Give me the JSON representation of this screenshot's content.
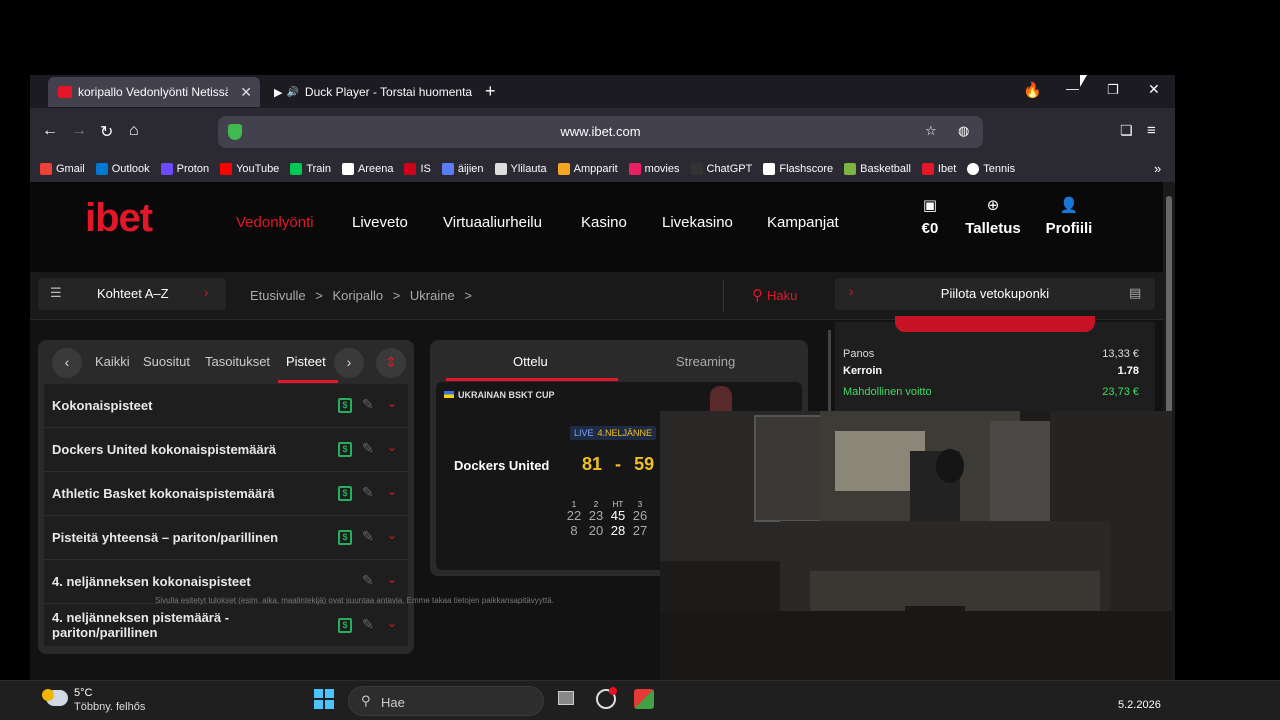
{
  "browser": {
    "tabs": [
      {
        "title": "koripallo Vedonlyönti Netissä |",
        "active": true
      },
      {
        "title": "Duck Player - Torstai huomenta",
        "active": false
      }
    ],
    "new_tab_glyph": "+",
    "url": "www.ibet.com",
    "window_controls": {
      "minimize": "—",
      "restore": "❐",
      "close": "✕"
    },
    "bookmarks": [
      {
        "label": "Gmail",
        "color": "#ea4335"
      },
      {
        "label": "Outlook",
        "color": "#0078d4"
      },
      {
        "label": "Proton",
        "color": "#6d4aff"
      },
      {
        "label": "YouTube",
        "color": "#ff0000"
      },
      {
        "label": "Train",
        "color": "#00c853"
      },
      {
        "label": "Areena",
        "color": "#ffffff"
      },
      {
        "label": "IS",
        "color": "#d0021b"
      },
      {
        "label": "äijien",
        "color": "#5b7cfa"
      },
      {
        "label": "Ylilauta",
        "color": "#dddddd"
      },
      {
        "label": "Ampparit",
        "color": "#f5a623"
      },
      {
        "label": "movies",
        "color": "#e91e63"
      },
      {
        "label": "ChatGPT",
        "color": "#333333"
      },
      {
        "label": "Flashscore",
        "color": "#ffffff"
      },
      {
        "label": "Basketball",
        "color": "#7cb342"
      },
      {
        "label": "Ibet",
        "color": "#e3162a"
      },
      {
        "label": "Tennis",
        "color": "#ffffff"
      }
    ]
  },
  "site": {
    "logo": "ibet",
    "nav": [
      "Vedonlyönti",
      "Liveveto",
      "Virtuaaliurheilu",
      "Kasino",
      "Livekasino",
      "Kampanjat"
    ],
    "active_nav": "Vedonlyönti",
    "balance": "€0",
    "deposit": "Talletus",
    "profile": "Profiili",
    "az_button": "Kohteet A–Z",
    "breadcrumb": [
      "Etusivulle",
      "Koripallo",
      "Ukraine"
    ],
    "search_label": "Haku",
    "coupon_label": "Piilota vetokuponki",
    "accent": "#e3162a"
  },
  "market_panel": {
    "tabs": [
      "Kaikki",
      "Suositut",
      "Tasoitukset",
      "Pisteet"
    ],
    "active_tab": "Pisteet",
    "markets": [
      {
        "label": "Kokonaispisteet",
        "cashout": true
      },
      {
        "label": "Dockers United kokonaispistemäärä",
        "cashout": true
      },
      {
        "label": "Athletic Basket kokonaispistemäärä",
        "cashout": true
      },
      {
        "label": "Pisteitä yhteensä – pariton/parillinen",
        "cashout": true
      },
      {
        "label": "4. neljänneksen kokonaispisteet",
        "cashout": false
      },
      {
        "label": "4. neljänneksen pistemäärä - pariton/parillinen",
        "cashout": true
      }
    ]
  },
  "match_panel": {
    "tabs": [
      "Ottelu",
      "Streaming"
    ],
    "active_tab": "Ottelu",
    "league": "UKRAINAN BSKT CUP",
    "live": "LIVE",
    "period": "4.NELJÄNNE",
    "home_team": "Dockers United",
    "score_home": "81",
    "score_sep": "-",
    "score_away": "59",
    "quarter_headers": [
      "1",
      "2",
      "HT",
      "3"
    ],
    "home_quarters": [
      "22",
      "23",
      "45",
      "26"
    ],
    "away_quarters": [
      "8",
      "20",
      "28",
      "27"
    ]
  },
  "betslip": {
    "stake_label": "Panos",
    "stake_value": "13,33 €",
    "odds_label": "Kerroin",
    "odds_value": "1.78",
    "win_label": "Mahdollinen voitto",
    "win_value": "23,73 €"
  },
  "footer": {
    "disclaimer": "Sivulla esitetyt tulokset (esim. aika, maalintekijä) ovat suuntaa antavia. Emme takaa tietojen paikkansapitävyyttä."
  },
  "taskbar": {
    "temperature": "5°C",
    "weather": "Többny. felhős",
    "search_placeholder": "Hae",
    "date": "5.2.2026"
  }
}
